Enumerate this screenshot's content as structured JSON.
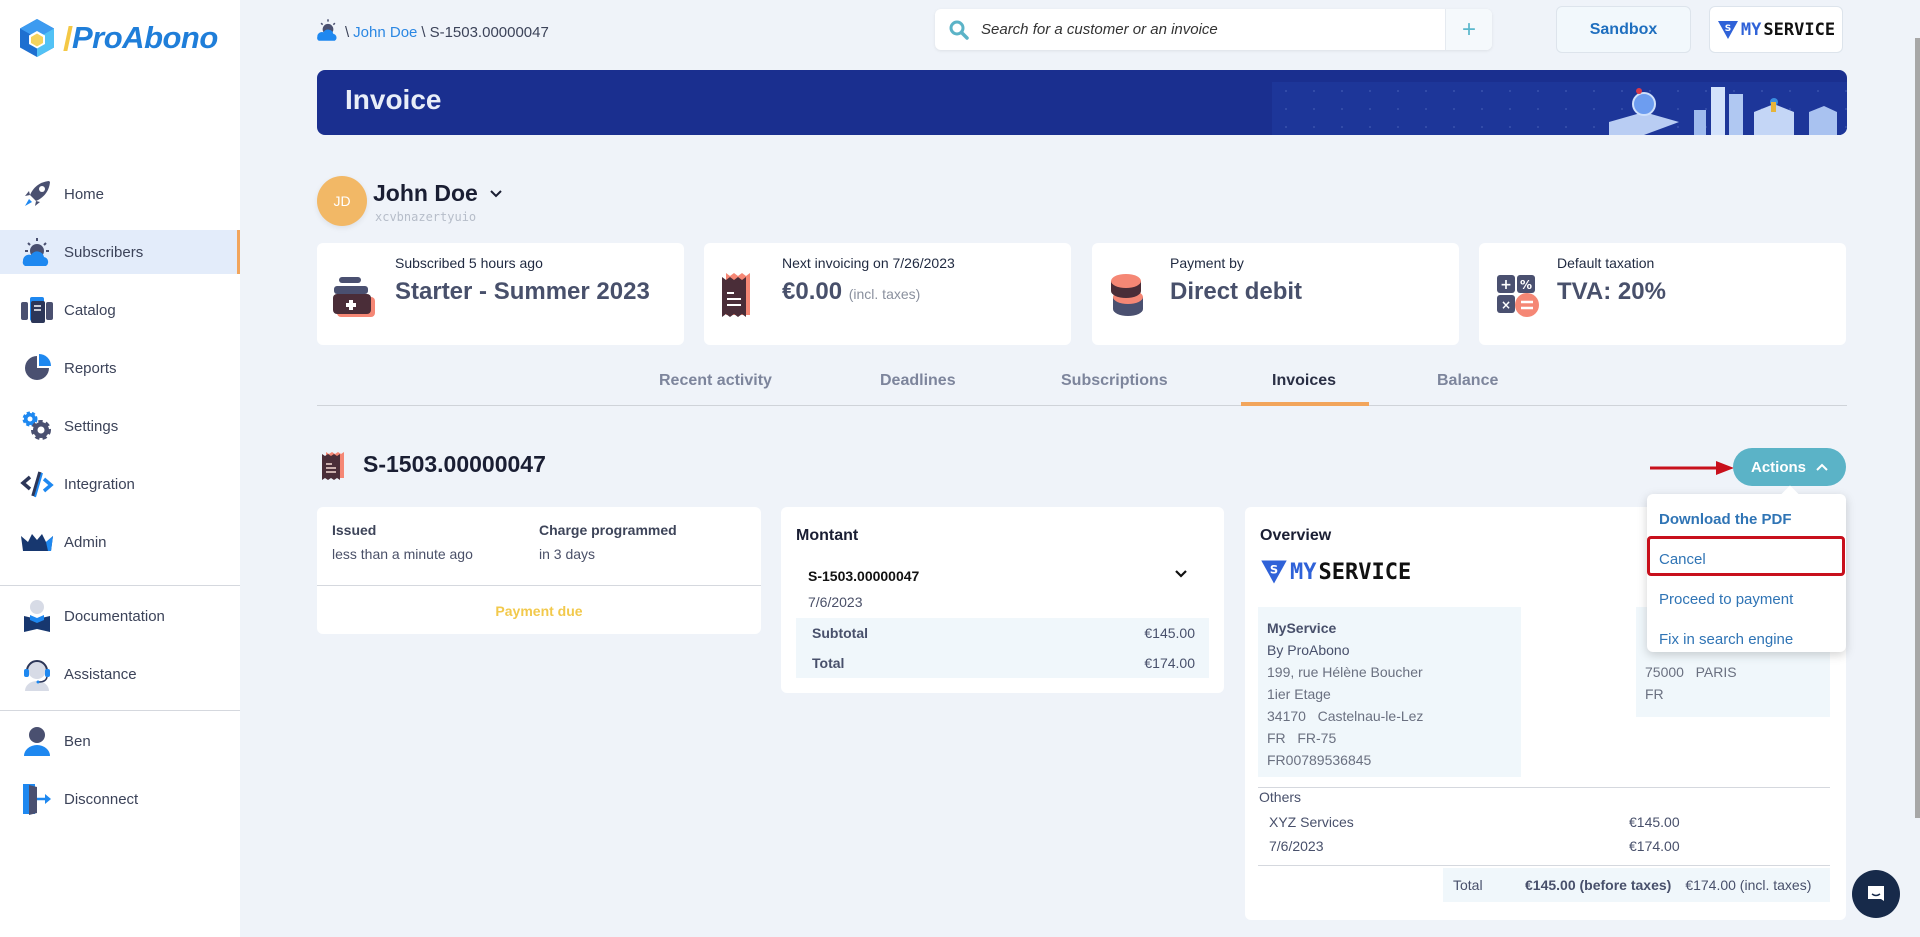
{
  "app": {
    "name": "ProAbono"
  },
  "sidebar": {
    "items": [
      {
        "label": "Home",
        "icon": "rocket-icon",
        "active": false
      },
      {
        "label": "Subscribers",
        "icon": "subscribers-icon",
        "active": true
      },
      {
        "label": "Catalog",
        "icon": "catalog-icon",
        "active": false
      },
      {
        "label": "Reports",
        "icon": "pie-chart-icon",
        "active": false
      },
      {
        "label": "Settings",
        "icon": "gears-icon",
        "active": false
      },
      {
        "label": "Integration",
        "icon": "code-icon",
        "active": false
      },
      {
        "label": "Admin",
        "icon": "crown-icon",
        "active": false
      }
    ],
    "help_items": [
      {
        "label": "Documentation",
        "icon": "book-icon"
      },
      {
        "label": "Assistance",
        "icon": "headset-icon"
      }
    ],
    "user_items": [
      {
        "label": "Ben",
        "icon": "user-icon"
      },
      {
        "label": "Disconnect",
        "icon": "door-exit-icon"
      }
    ]
  },
  "breadcrumb": {
    "separator": "\\",
    "customer": "John Doe",
    "invoice": "S-1503.00000047"
  },
  "search": {
    "placeholder": "Search for a customer or an invoice",
    "value": "",
    "add_label": "+"
  },
  "topbar": {
    "sandbox_label": "Sandbox",
    "brand": {
      "prefix": "S",
      "my": "MY",
      "service": "SERVICE"
    }
  },
  "banner": {
    "title": "Invoice"
  },
  "customer": {
    "initials": "JD",
    "name": "John Doe",
    "reference": "xcvbnazertyuio"
  },
  "stats": [
    {
      "label": "Subscribed 5 hours ago",
      "value": "Starter - Summer 2023",
      "sub": ""
    },
    {
      "label": "Next invoicing on 7/26/2023",
      "value": "€0.00",
      "sub": "(incl. taxes)"
    },
    {
      "label": "Payment by",
      "value": "Direct debit",
      "sub": ""
    },
    {
      "label": "Default taxation",
      "value": "TVA: 20%",
      "sub": ""
    }
  ],
  "tabs": [
    {
      "label": "Recent activity",
      "active": false
    },
    {
      "label": "Deadlines",
      "active": false
    },
    {
      "label": "Subscriptions",
      "active": false
    },
    {
      "label": "Invoices",
      "active": true
    },
    {
      "label": "Balance",
      "active": false
    }
  ],
  "invoice": {
    "number": "S-1503.00000047",
    "actions_label": "Actions",
    "actions_menu": [
      "Download the PDF",
      "Cancel",
      "Proceed to payment",
      "Fix in search engine"
    ],
    "highlighted_action": "Cancel",
    "status_panel": {
      "issued_label": "Issued",
      "issued_value": "less than a minute ago",
      "charge_label": "Charge programmed",
      "charge_value": "in 3 days",
      "status": "Payment due",
      "status_color": "#f2c94c"
    },
    "amount_panel": {
      "title": "Montant",
      "invoice_ref": "S-1503.00000047",
      "date": "7/6/2023",
      "subtotal_label": "Subtotal",
      "subtotal_value": "€145.00",
      "total_label": "Total",
      "total_value": "€174.00"
    },
    "overview_panel": {
      "title": "Overview",
      "seller": {
        "name": "MyService",
        "lines": [
          "By ProAbono",
          "199, rue Hélène Boucher",
          "1ier Etage",
          "34170   Castelnau-le-Lez",
          "FR   FR-75",
          "FR00789536845"
        ]
      },
      "buyer": {
        "lines": [
          "75000   PARIS",
          "FR"
        ]
      },
      "others_label": "Others",
      "lines": [
        {
          "label": "XYZ Services",
          "amount": "€145.00"
        },
        {
          "label": "7/6/2023",
          "amount": "€174.00"
        }
      ],
      "total_label": "Total",
      "total_before_taxes": "€145.00 (before taxes)",
      "total_incl_taxes": "€174.00 (incl. taxes)"
    }
  },
  "colors": {
    "accent": "#2b87e3",
    "banner": "#1a2f8f",
    "tab_active": "#f2a55c",
    "actions": "#5bb3c7",
    "highlight": "#c8101c"
  }
}
